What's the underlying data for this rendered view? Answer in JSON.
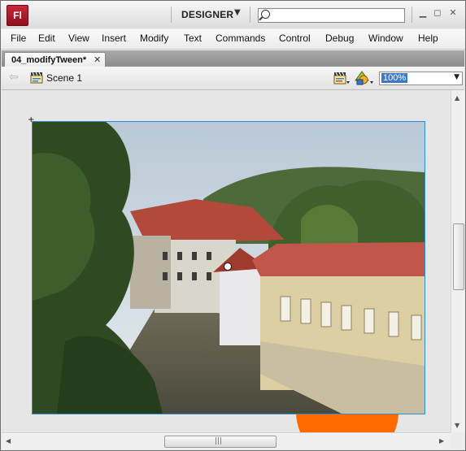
{
  "titlebar": {
    "app_logo_text": "Fl",
    "workspace_label": "DESIGNER",
    "workspace_caret_icon": "dropdown-triangle-icon",
    "search_placeholder": "",
    "window_buttons": [
      "minimize-icon",
      "restore-icon",
      "close-icon"
    ]
  },
  "menu": {
    "items": [
      "File",
      "Edit",
      "View",
      "Insert",
      "Modify",
      "Text",
      "Commands",
      "Control",
      "Debug",
      "Window",
      "Help"
    ]
  },
  "tabs": {
    "active_document": "04_modifyTween*",
    "close_glyph": "✕"
  },
  "editbar": {
    "scene_label": "Scene 1",
    "zoom_value": "100%"
  },
  "stage": {
    "content": "canal-photo",
    "shape_color": "#ff6a00",
    "selection_color": "#2e8fd9"
  },
  "colors": {
    "logo_red": "#b01e2f",
    "zoom_highlight": "#3a79c9"
  }
}
